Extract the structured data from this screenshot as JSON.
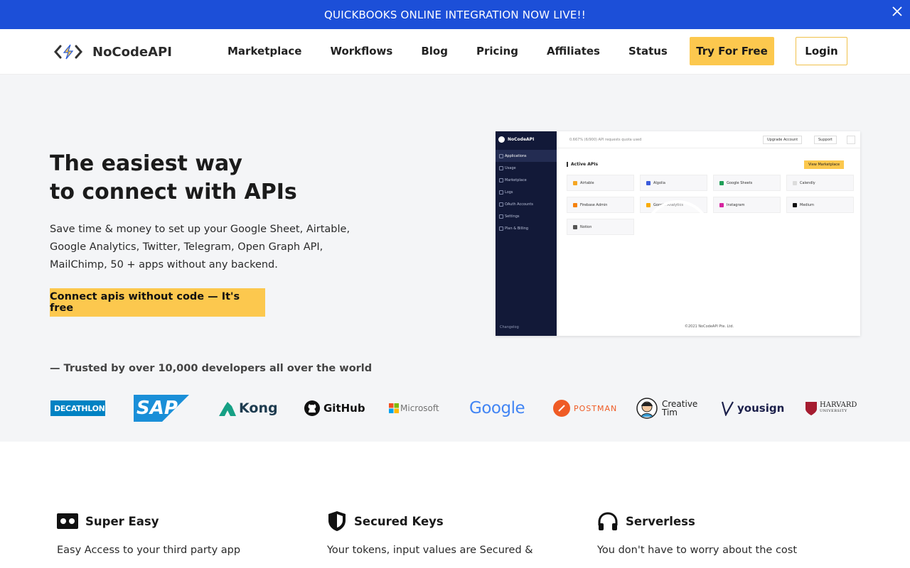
{
  "announcement": {
    "text": "QUICKBOOKS ONLINE INTEGRATION NOW LIVE!!"
  },
  "header": {
    "brand": "NoCodeAPI",
    "nav": [
      "Marketplace",
      "Workflows",
      "Blog",
      "Pricing",
      "Affiliates",
      "Status"
    ],
    "try_label": "Try For Free",
    "login_label": "Login"
  },
  "hero": {
    "title_line1": "The easiest way",
    "title_line2": "to connect with APIs",
    "description": "Save time & money to set up your Google Sheet, Airtable, Google Analytics, Twitter, Telegram, Open Graph API, MailChimp, 50 + apps without any backend.",
    "cta_label": "Connect apis without code — It's free",
    "trusted": "— Trusted by over 10,000 developers all over the world"
  },
  "preview": {
    "brand": "NoCodeAPI",
    "menu": [
      "Applications",
      "Usage",
      "Marketplace",
      "Logs",
      "OAuth Accounts",
      "Settings",
      "Plan & Billing"
    ],
    "changelog": "Changelog",
    "quota": "0.667% (6/900) API requests quota used",
    "upgrade_label": "Upgrade Account",
    "support_label": "Support",
    "active_title": "Active APIs",
    "marketplace_label": "View Marketplace",
    "apis": [
      {
        "name": "Airtable",
        "color": "#f5a623"
      },
      {
        "name": "Algolia",
        "color": "#3b5bdb"
      },
      {
        "name": "Google Sheets",
        "color": "#1e9e57"
      },
      {
        "name": "Calendly",
        "color": "#dcdcdc"
      },
      {
        "name": "Firebase Admin",
        "color": "#f5820d"
      },
      {
        "name": "Google Analytics",
        "color": "#f9ab00"
      },
      {
        "name": "Instagram",
        "color": "#d6249f"
      },
      {
        "name": "Medium",
        "color": "#111111"
      },
      {
        "name": "Notion",
        "color": "#555555"
      }
    ],
    "footer": "©2021 NoCodeAPI Pte. Ltd."
  },
  "logos": {
    "decathlon": "DECATHLON",
    "sap": "SAP",
    "kong": "Kong",
    "github": "GitHub",
    "microsoft": "Microsoft",
    "google": "Google",
    "postman": "POSTMAN",
    "creative_tim_line1": "Creative",
    "creative_tim_line2": "Tim",
    "yousign": "yousign",
    "harvard_line1": "HARVARD",
    "harvard_line2": "UNIVERSITY"
  },
  "features": [
    {
      "title": "Super Easy",
      "text": "Easy Access to your third party app",
      "icon": "cassette-icon"
    },
    {
      "title": "Secured Keys",
      "text": "Your tokens, input values are Secured &",
      "icon": "shield-icon"
    },
    {
      "title": "Serverless",
      "text": "You don't have to worry about the cost",
      "icon": "headphones-icon"
    }
  ],
  "colors": {
    "accent": "#fcc84e",
    "banner": "#1c4fd8",
    "sidebar": "#121938"
  }
}
